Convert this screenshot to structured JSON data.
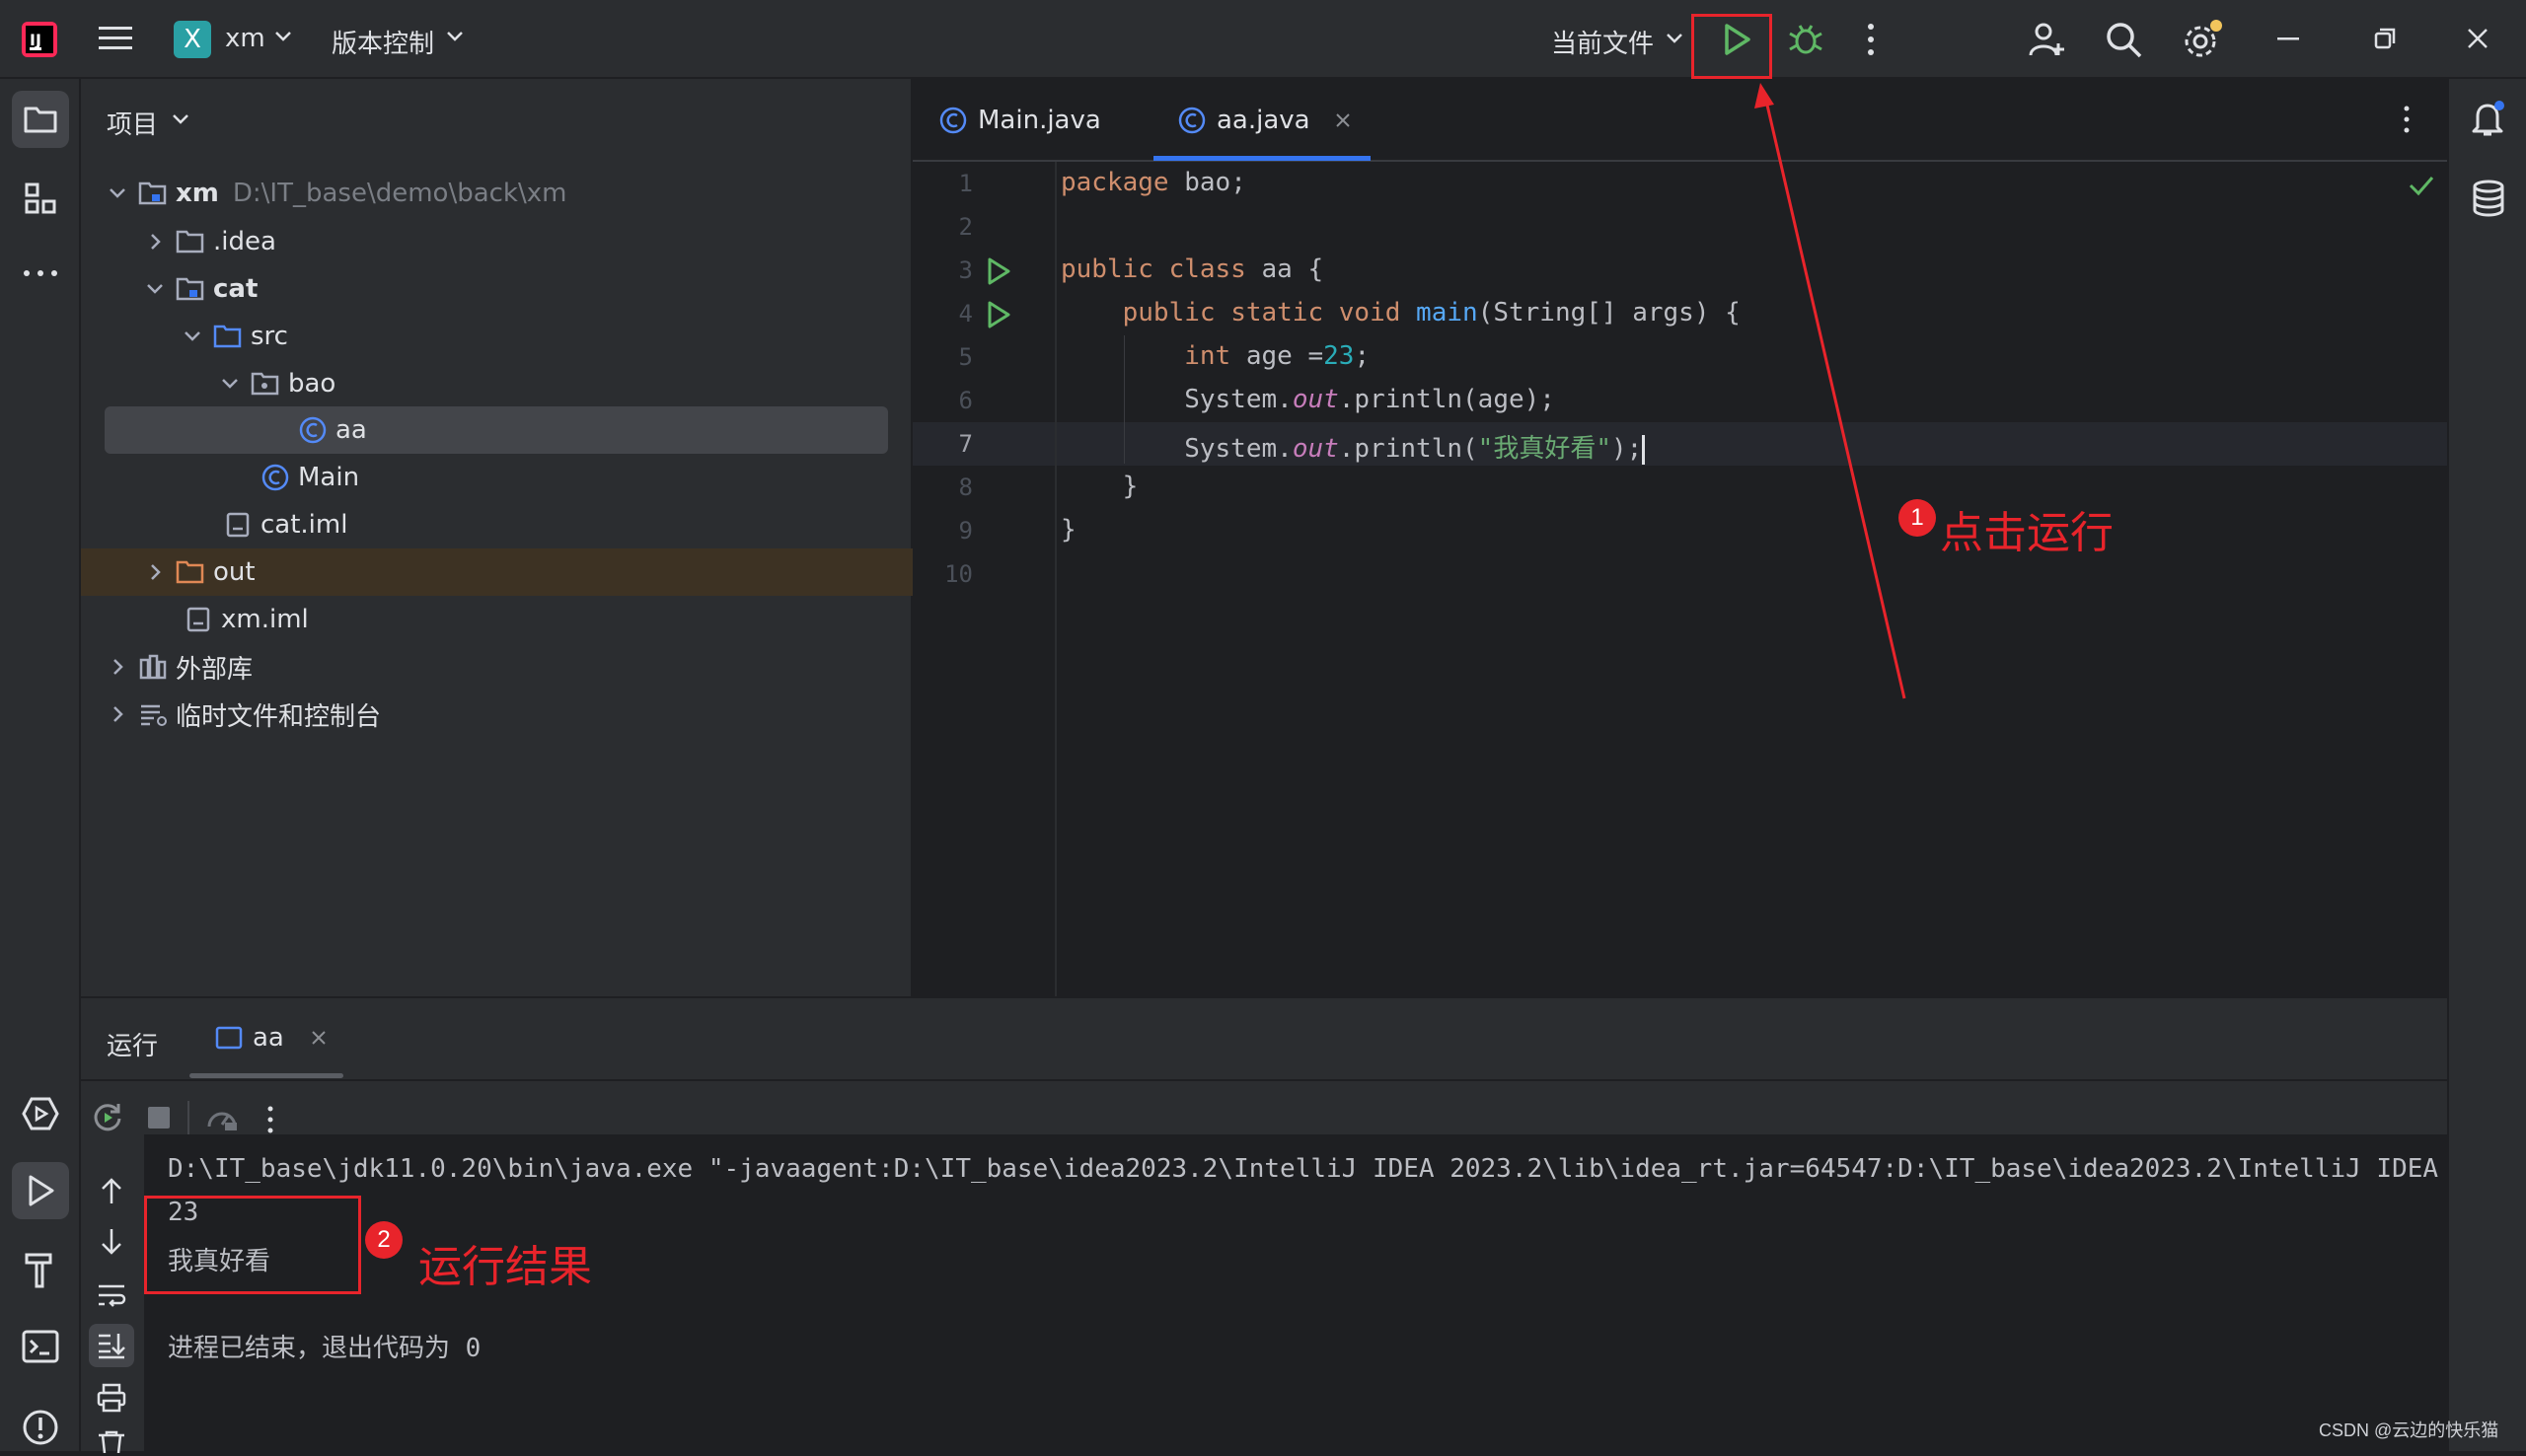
{
  "titlebar": {
    "project_badge": "X",
    "project_name": "xm",
    "vcs_menu": "版本控制",
    "run_config": "当前文件"
  },
  "project_panel": {
    "title": "项目",
    "tree": [
      {
        "name": "xm",
        "path": "D:\\IT_base\\demo\\back\\xm"
      },
      {
        "name": ".idea"
      },
      {
        "name": "cat"
      },
      {
        "name": "src"
      },
      {
        "name": "bao"
      },
      {
        "name": "aa"
      },
      {
        "name": "Main"
      },
      {
        "name": "cat.iml"
      },
      {
        "name": "out"
      },
      {
        "name": "xm.iml"
      },
      {
        "name": "外部库"
      },
      {
        "name": "临时文件和控制台"
      }
    ]
  },
  "editor": {
    "tabs": [
      {
        "label": "Main.java"
      },
      {
        "label": "aa.java"
      }
    ],
    "line_numbers": [
      "1",
      "2",
      "3",
      "4",
      "5",
      "6",
      "7",
      "8",
      "9",
      "10"
    ]
  },
  "run_panel": {
    "title": "运行",
    "tab_label": "aa",
    "console": {
      "command": "D:\\IT_base\\jdk11.0.20\\bin\\java.exe \"-javaagent:D:\\IT_base\\idea2023.2\\IntelliJ IDEA 2023.2\\lib\\idea_rt.jar=64547:D:\\IT_base\\idea2023.2\\IntelliJ IDEA",
      "output_1": "23",
      "output_2": "我真好看",
      "exit_message": "进程已结束，退出代码为 0"
    }
  },
  "annotations": {
    "step1_num": "1",
    "step1_text": "点击运行",
    "step2_num": "2",
    "step2_text": "运行结果"
  },
  "watermark": "CSDN @云边的快乐猫",
  "colors": {
    "accent_blue": "#3574f0",
    "run_green": "#5fb865",
    "annotation_red": "#e8242b"
  }
}
